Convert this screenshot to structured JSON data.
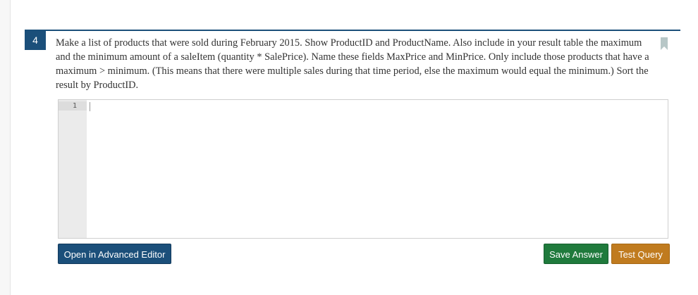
{
  "question": {
    "number": "4",
    "text": "Make a list of products that were sold during February 2015.  Show ProductID and ProductName.  Also include in your result table the maximum and the minimum amount of a saleItem (quantity * SalePrice).  Name these fields MaxPrice and MinPrice. Only include those products that have a maximum > minimum. (This means that there were multiple sales during that time period, else the maximum would equal the minimum.)  Sort the result by ProductID."
  },
  "editor": {
    "line_numbers": [
      "1"
    ],
    "content": ""
  },
  "buttons": {
    "advanced_editor": "Open in Advanced Editor",
    "save_answer": "Save Answer",
    "test_query": "Test Query"
  },
  "colors": {
    "accent": "#1b4f7a",
    "save": "#1f7a3c",
    "test": "#c07b1f",
    "bookmark": "#b7c7c7"
  },
  "icons": {
    "bookmark": "bookmark-icon"
  }
}
